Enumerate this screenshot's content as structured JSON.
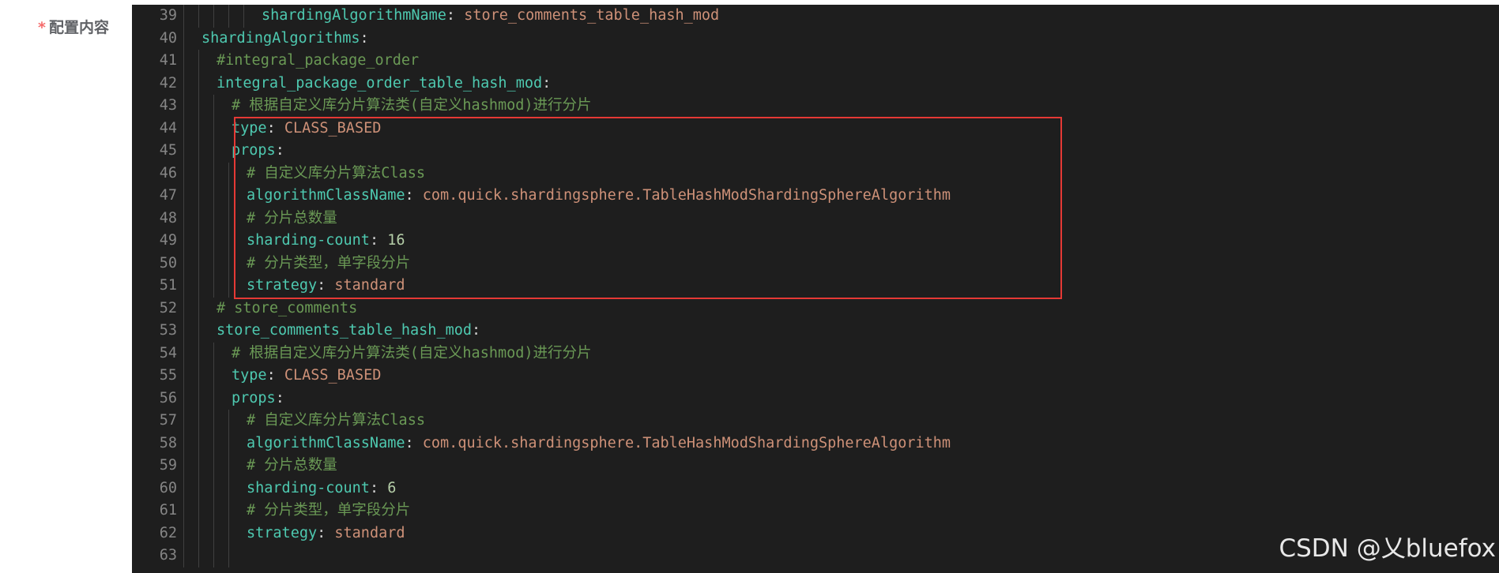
{
  "form": {
    "required_mark": "*",
    "label": "配置内容"
  },
  "editor": {
    "lines": [
      {
        "num": "39",
        "indent": 5,
        "tokens": [
          {
            "t": "shardingAlgorithmName",
            "c": "k"
          },
          {
            "t": ": ",
            "c": "p"
          },
          {
            "t": "store_comments_table_hash_mod",
            "c": "s"
          }
        ]
      },
      {
        "num": "40",
        "indent": 1,
        "tokens": [
          {
            "t": "shardingAlgorithms",
            "c": "k"
          },
          {
            "t": ":",
            "c": "p"
          }
        ]
      },
      {
        "num": "41",
        "indent": 2,
        "tokens": [
          {
            "t": "#integral_package_order",
            "c": "c"
          }
        ]
      },
      {
        "num": "42",
        "indent": 2,
        "tokens": [
          {
            "t": "integral_package_order_table_hash_mod",
            "c": "k"
          },
          {
            "t": ":",
            "c": "p"
          }
        ]
      },
      {
        "num": "43",
        "indent": 3,
        "tokens": [
          {
            "t": "# 根据自定义库分片算法类(自定义hashmod)进行分片",
            "c": "c"
          }
        ]
      },
      {
        "num": "44",
        "indent": 3,
        "tokens": [
          {
            "t": "type",
            "c": "k"
          },
          {
            "t": ": ",
            "c": "p"
          },
          {
            "t": "CLASS_BASED",
            "c": "s"
          }
        ]
      },
      {
        "num": "45",
        "indent": 3,
        "tokens": [
          {
            "t": "props",
            "c": "k"
          },
          {
            "t": ":",
            "c": "p"
          }
        ]
      },
      {
        "num": "46",
        "indent": 4,
        "tokens": [
          {
            "t": "# 自定义库分片算法Class",
            "c": "c"
          }
        ]
      },
      {
        "num": "47",
        "indent": 4,
        "tokens": [
          {
            "t": "algorithmClassName",
            "c": "k"
          },
          {
            "t": ": ",
            "c": "p"
          },
          {
            "t": "com.quick.shardingsphere.TableHashModShardingSphereAlgorithm",
            "c": "s"
          }
        ]
      },
      {
        "num": "48",
        "indent": 4,
        "tokens": [
          {
            "t": "# 分片总数量",
            "c": "c"
          }
        ]
      },
      {
        "num": "49",
        "indent": 4,
        "tokens": [
          {
            "t": "sharding-count",
            "c": "k"
          },
          {
            "t": ": ",
            "c": "p"
          },
          {
            "t": "16",
            "c": "n"
          }
        ]
      },
      {
        "num": "50",
        "indent": 4,
        "tokens": [
          {
            "t": "# 分片类型，单字段分片",
            "c": "c"
          }
        ]
      },
      {
        "num": "51",
        "indent": 4,
        "tokens": [
          {
            "t": "strategy",
            "c": "k"
          },
          {
            "t": ": ",
            "c": "p"
          },
          {
            "t": "standard",
            "c": "s"
          }
        ]
      },
      {
        "num": "52",
        "indent": 2,
        "tokens": [
          {
            "t": "# store_comments",
            "c": "c"
          }
        ]
      },
      {
        "num": "53",
        "indent": 2,
        "tokens": [
          {
            "t": "store_comments_table_hash_mod",
            "c": "k"
          },
          {
            "t": ":",
            "c": "p"
          }
        ]
      },
      {
        "num": "54",
        "indent": 3,
        "tokens": [
          {
            "t": "# 根据自定义库分片算法类(自定义hashmod)进行分片",
            "c": "c"
          }
        ]
      },
      {
        "num": "55",
        "indent": 3,
        "tokens": [
          {
            "t": "type",
            "c": "k"
          },
          {
            "t": ": ",
            "c": "p"
          },
          {
            "t": "CLASS_BASED",
            "c": "s"
          }
        ]
      },
      {
        "num": "56",
        "indent": 3,
        "tokens": [
          {
            "t": "props",
            "c": "k"
          },
          {
            "t": ":",
            "c": "p"
          }
        ]
      },
      {
        "num": "57",
        "indent": 4,
        "tokens": [
          {
            "t": "# 自定义库分片算法Class",
            "c": "c"
          }
        ]
      },
      {
        "num": "58",
        "indent": 4,
        "tokens": [
          {
            "t": "algorithmClassName",
            "c": "k"
          },
          {
            "t": ": ",
            "c": "p"
          },
          {
            "t": "com.quick.shardingsphere.TableHashModShardingSphereAlgorithm",
            "c": "s"
          }
        ]
      },
      {
        "num": "59",
        "indent": 4,
        "tokens": [
          {
            "t": "# 分片总数量",
            "c": "c"
          }
        ]
      },
      {
        "num": "60",
        "indent": 4,
        "tokens": [
          {
            "t": "sharding-count",
            "c": "k"
          },
          {
            "t": ": ",
            "c": "p"
          },
          {
            "t": "6",
            "c": "n"
          }
        ]
      },
      {
        "num": "61",
        "indent": 4,
        "tokens": [
          {
            "t": "# 分片类型，单字段分片",
            "c": "c"
          }
        ]
      },
      {
        "num": "62",
        "indent": 4,
        "tokens": [
          {
            "t": "strategy",
            "c": "k"
          },
          {
            "t": ": ",
            "c": "p"
          },
          {
            "t": "standard",
            "c": "s"
          }
        ]
      },
      {
        "num": "63",
        "indent": 0,
        "tokens": []
      }
    ],
    "highlight": {
      "from_line": "44",
      "to_line": "51",
      "color": "#e53935"
    }
  },
  "watermark": "CSDN @乂bluefox",
  "colors": {
    "editor_bg": "#1e1e1e",
    "line_number": "#858585",
    "key": "#4ec9b0",
    "string": "#ce9178",
    "number": "#b5cea8",
    "comment": "#6a9955",
    "required": "#f56c6c"
  }
}
